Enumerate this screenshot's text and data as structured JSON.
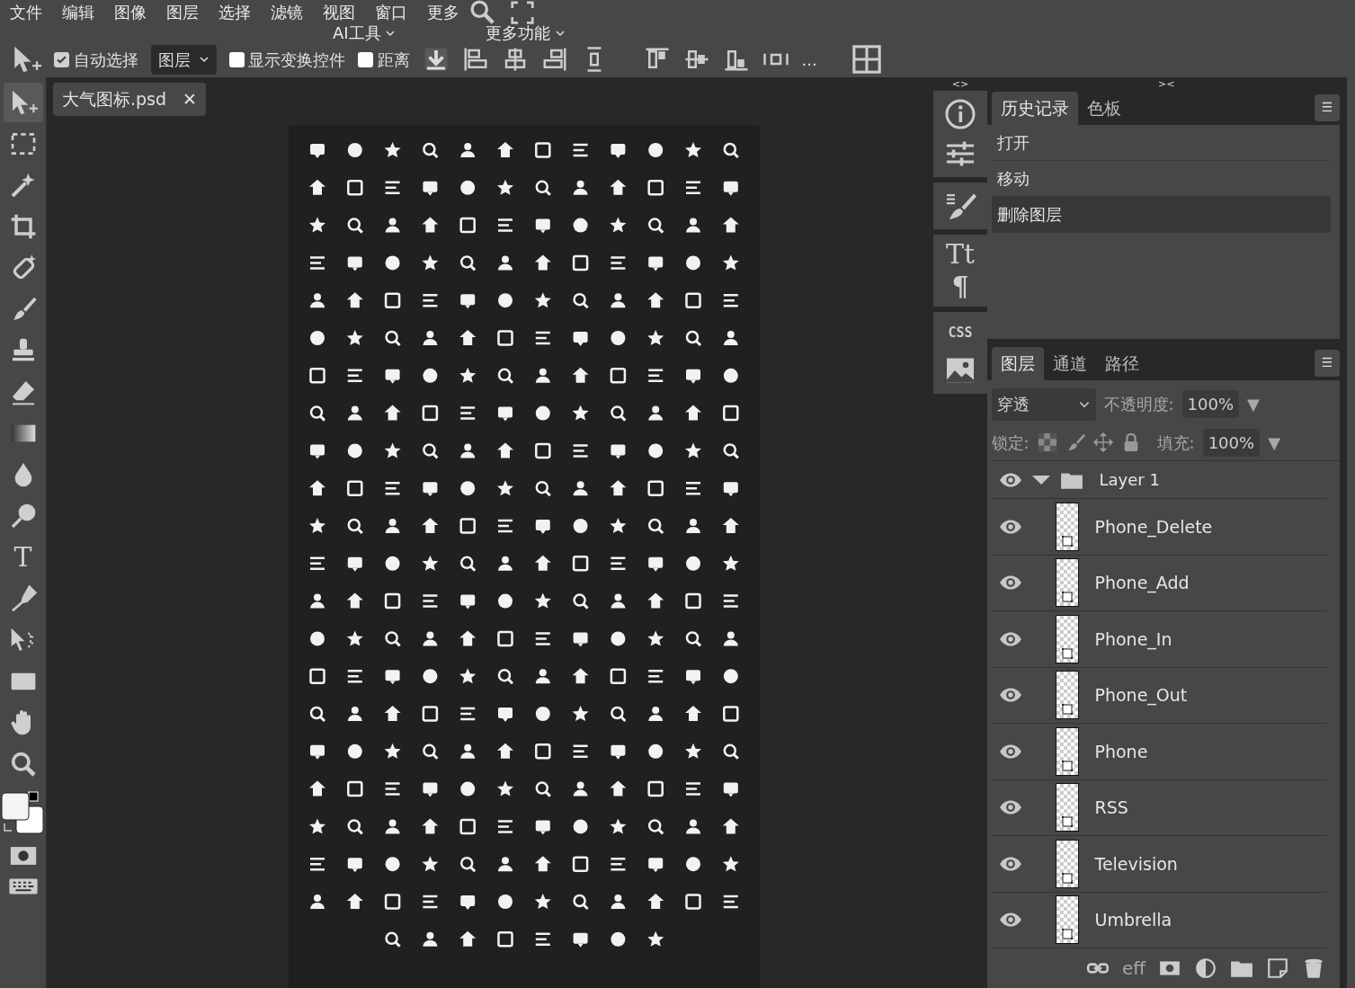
{
  "menu_bar": {
    "items": [
      "文件",
      "编辑",
      "图像",
      "图层",
      "选择",
      "滤镜",
      "视图",
      "窗口",
      "更多"
    ],
    "sub_items": [
      "AI工具",
      "更多功能"
    ]
  },
  "options_bar": {
    "auto_select": {
      "label": "自动选择",
      "checked": true
    },
    "layer_dropdown": "图层",
    "show_transform": {
      "label": "显示变换控件",
      "checked": false
    },
    "distance": {
      "label": "距离",
      "checked": false
    },
    "more": "..."
  },
  "tools": [
    {
      "selected": true
    },
    {
      "selected": false
    },
    {
      "selected": false
    },
    {
      "selected": false
    },
    {
      "selected": false
    },
    {
      "selected": false
    },
    {
      "selected": false
    },
    {
      "selected": false
    },
    {
      "selected": false
    },
    {
      "selected": false
    },
    {
      "selected": false
    },
    {
      "selected": false,
      "glyph": "T"
    },
    {
      "selected": false
    },
    {
      "selected": false
    },
    {
      "selected": false
    },
    {
      "selected": false
    },
    {
      "selected": false
    }
  ],
  "document_tab": {
    "title": "大气图标.psd",
    "close": "✕"
  },
  "dock": {
    "expand": "<>",
    "collapse": "><",
    "type_glyph": "Tt",
    "paragraph_glyph": "¶",
    "css_label": "CSS"
  },
  "history_panel": {
    "tabs": [
      {
        "label": "历史记录",
        "selected": true
      },
      {
        "label": "色板",
        "selected": false
      }
    ],
    "menu": "☰",
    "items": [
      {
        "label": "打开",
        "selected": false
      },
      {
        "label": "移动",
        "selected": false
      },
      {
        "label": "删除图层",
        "selected": true
      }
    ]
  },
  "layers_panel": {
    "tabs": [
      {
        "label": "图层",
        "selected": true
      },
      {
        "label": "通道",
        "selected": false
      },
      {
        "label": "路径",
        "selected": false
      }
    ],
    "menu": "☰",
    "blend_mode": "穿透",
    "opacity_label": "不透明度:",
    "opacity": "100%",
    "opacity_arrow": "▼",
    "lock_label": "锁定:",
    "fill_label": "填充:",
    "fill": "100%",
    "fill_arrow": "▼",
    "layers": [
      {
        "name": "Layer 1",
        "kind": "group",
        "visible": true,
        "expanded": true,
        "children": [
          {
            "name": "Phone_Delete",
            "kind": "layer",
            "visible": true
          },
          {
            "name": "Phone_Add",
            "kind": "layer",
            "visible": true
          },
          {
            "name": "Phone_In",
            "kind": "layer",
            "visible": true
          },
          {
            "name": "Phone_Out",
            "kind": "layer",
            "visible": true
          },
          {
            "name": "Phone",
            "kind": "layer",
            "visible": true
          },
          {
            "name": "RSS",
            "kind": "layer",
            "visible": true
          },
          {
            "name": "Television",
            "kind": "layer",
            "visible": true
          },
          {
            "name": "Umbrella",
            "kind": "layer",
            "visible": true
          }
        ]
      }
    ],
    "footer_effects": "eff"
  }
}
